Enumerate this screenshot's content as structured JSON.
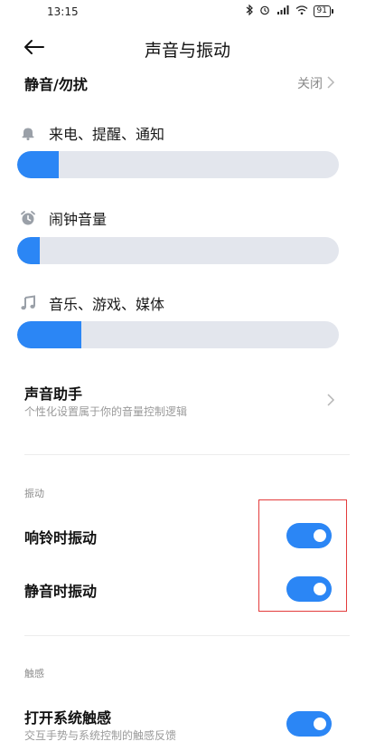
{
  "status_bar": {
    "time": "13:15",
    "battery": "91"
  },
  "header": {
    "title": "声音与振动"
  },
  "silent": {
    "title": "静音/勿扰",
    "value": "关闭"
  },
  "volumes": [
    {
      "label": "来电、提醒、通知",
      "icon": "bell-icon",
      "level": 0.13
    },
    {
      "label": "闹钟音量",
      "icon": "alarm-clock-icon",
      "level": 0.07
    },
    {
      "label": "音乐、游戏、媒体",
      "icon": "music-note-icon",
      "level": 0.2
    }
  ],
  "sound_assistant": {
    "title": "声音助手",
    "subtitle": "个性化设置属于你的音量控制逻辑"
  },
  "vibration": {
    "section_label": "振动",
    "ring_label": "响铃时振动",
    "ring_on": true,
    "silent_label": "静音时振动",
    "silent_on": true
  },
  "haptics": {
    "section_label": "触感",
    "title": "打开系统触感",
    "subtitle": "交互手势与系统控制的触感反馈",
    "on": true
  },
  "colors": {
    "accent": "#2b86f5",
    "track": "#e3e6ed",
    "highlight": "#e33b3b"
  }
}
